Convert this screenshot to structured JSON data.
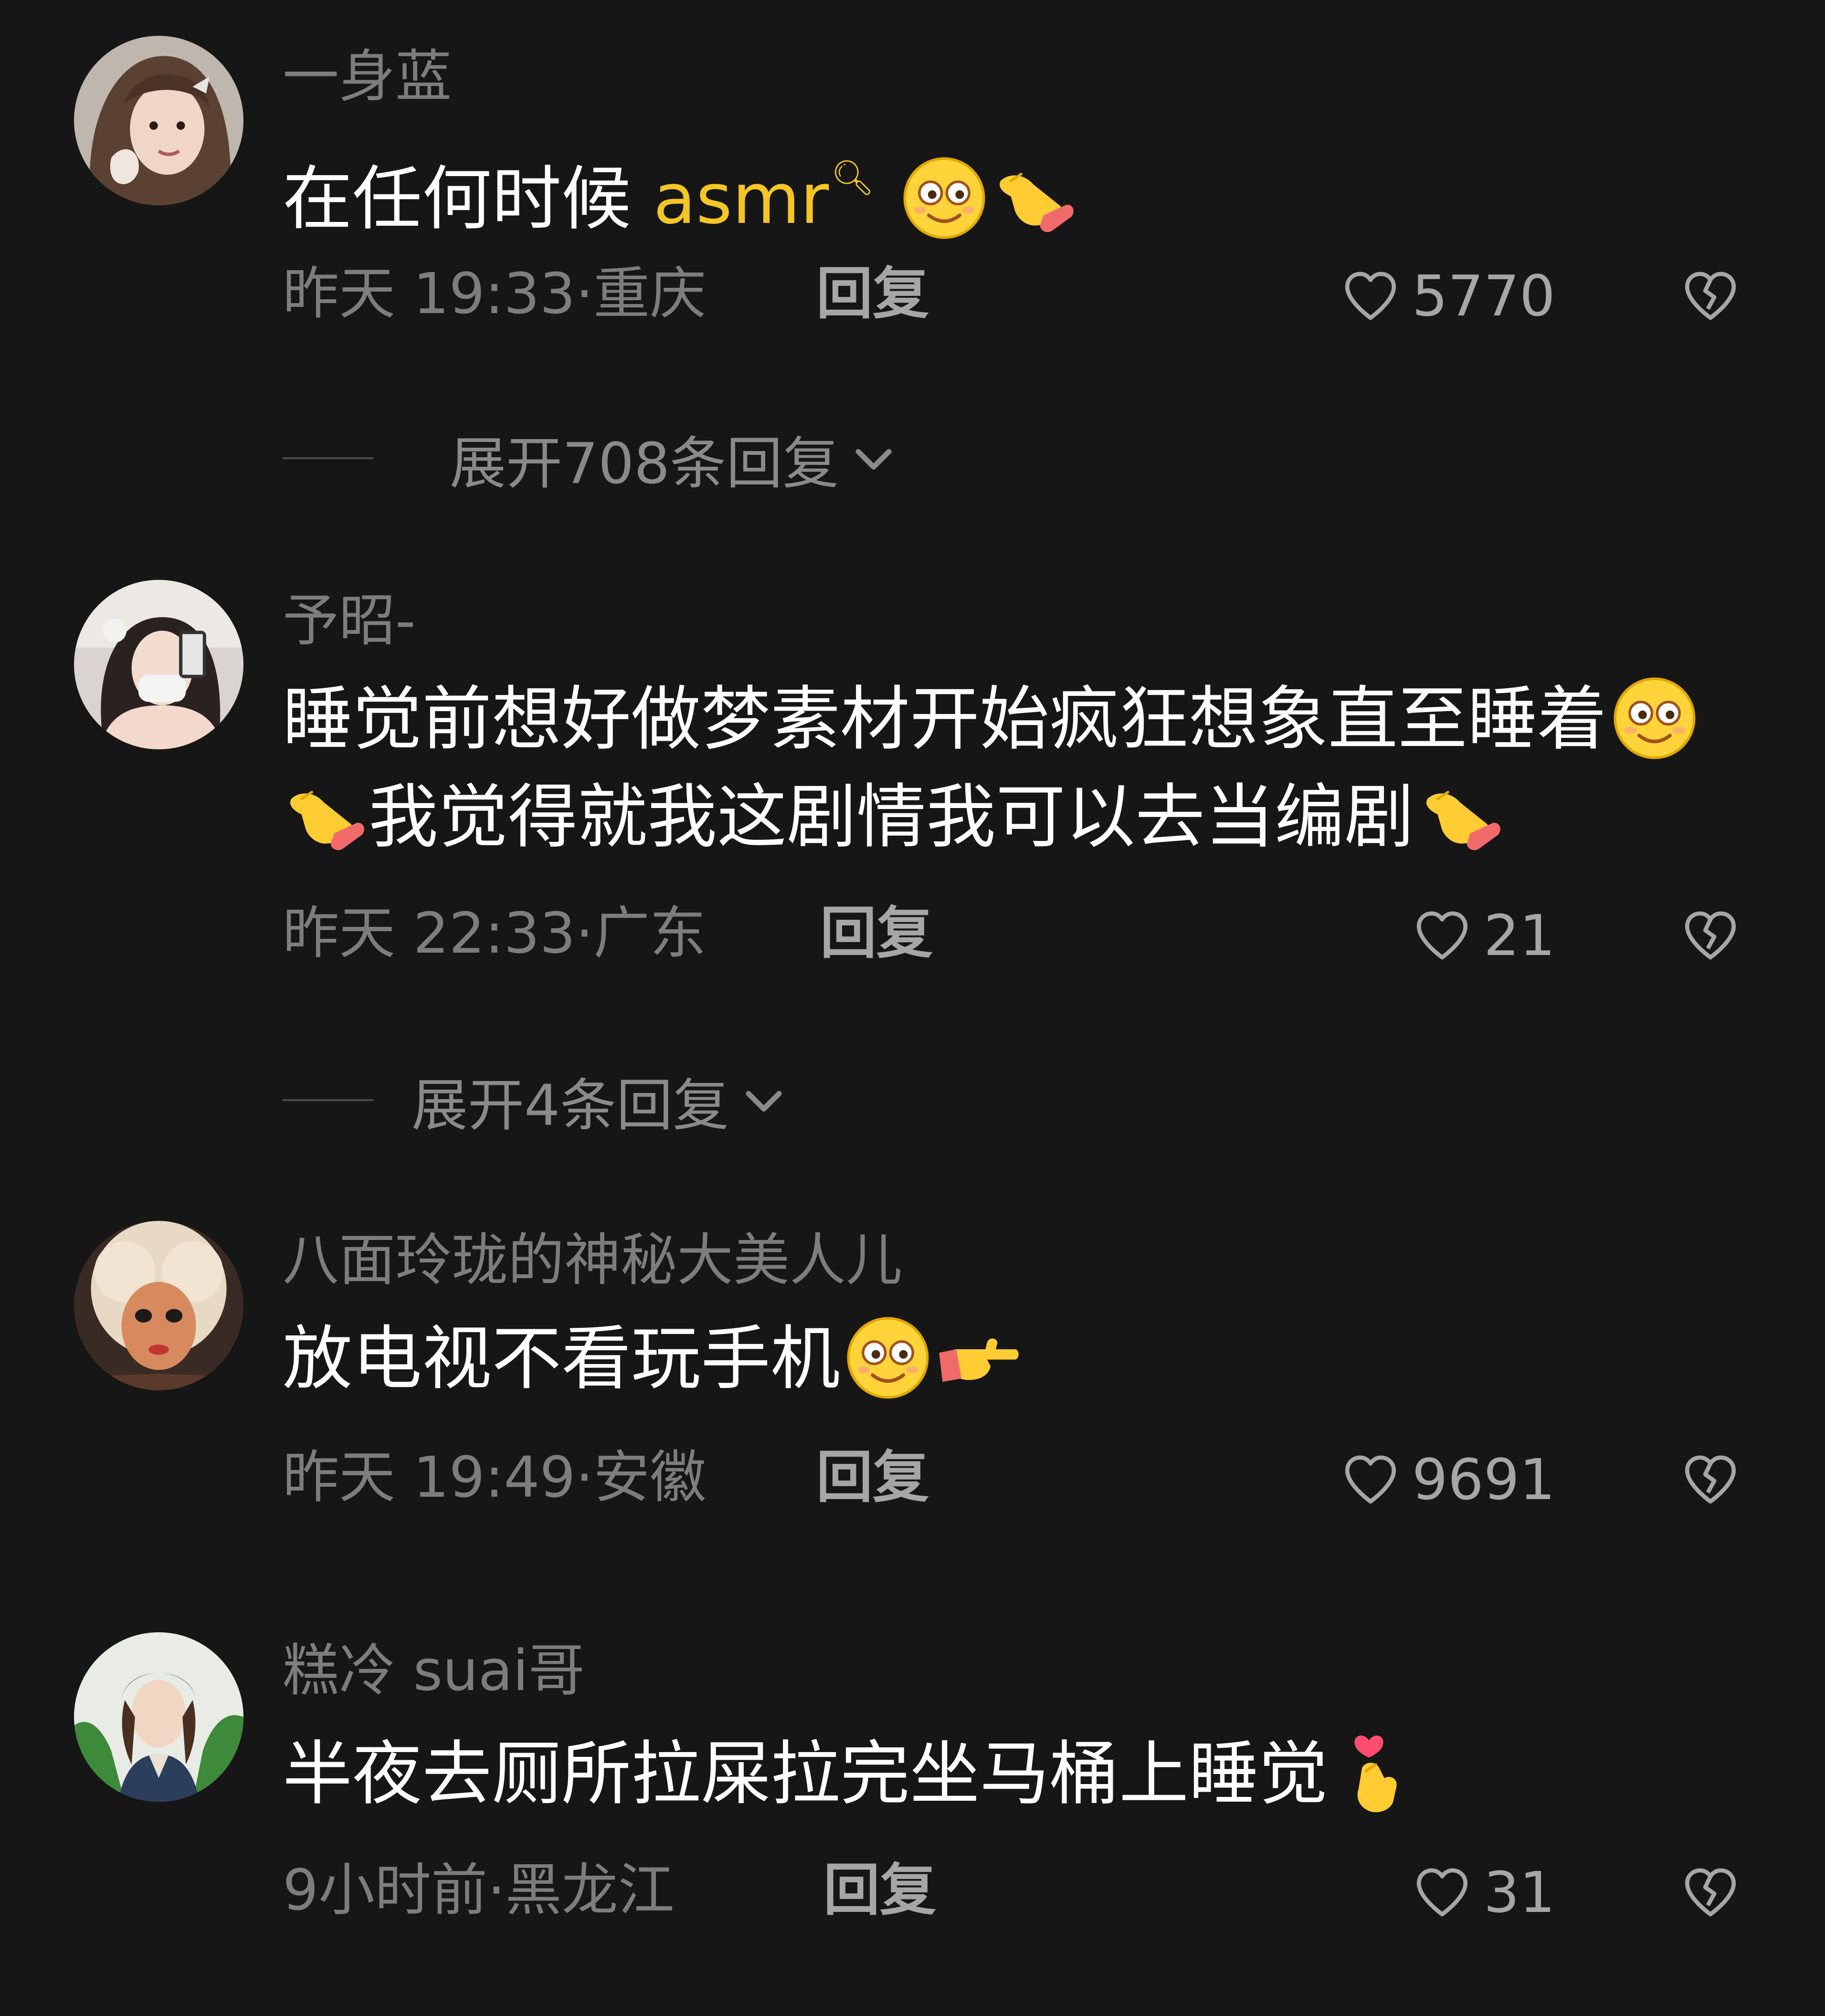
{
  "comments": [
    {
      "username": "一身蓝",
      "text_before": "在任何时候 ",
      "topic": "asmr",
      "text_after": "",
      "text_line2": "",
      "time": "昨天 19:33",
      "location": "重庆",
      "reply_label": "回复",
      "likes": "5770",
      "expand_label": "展开708条回复",
      "emojis_line1": [
        "flushed-emoji-icon",
        "pointing-hand-emoji-icon"
      ]
    },
    {
      "username": "予昭-",
      "text_before": "睡觉前想好做梦素材开始疯狂想象直至睡着",
      "text_line2": "我觉得就我这剧情我可以去当编剧",
      "time": "昨天 22:33",
      "location": "广东",
      "reply_label": "回复",
      "likes": "21",
      "expand_label": "展开4条回复",
      "emojis_line1": [
        "flushed-emoji-icon"
      ]
    },
    {
      "username": "八面玲珑的神秘大美人儿",
      "text_before": "放电视不看玩手机",
      "time": "昨天 19:49",
      "location": "安徽",
      "reply_label": "回复",
      "likes": "9691",
      "emojis_line1": [
        "flushed-emoji-icon",
        "pointing-right-emoji-icon"
      ]
    },
    {
      "username": "糕冷 suai哥",
      "text_before": "半夜去厕所拉屎拉完坐马桶上睡觉",
      "time": "9小时前",
      "location": "黑龙江",
      "reply_label": "回复",
      "likes": "31",
      "emojis_line1": [
        "finger-heart-emoji-icon"
      ]
    }
  ],
  "separator": "·",
  "colors": {
    "background": "#161616",
    "text": "#ffffff",
    "muted": "#7d7d7d",
    "topic": "#f3c623"
  }
}
